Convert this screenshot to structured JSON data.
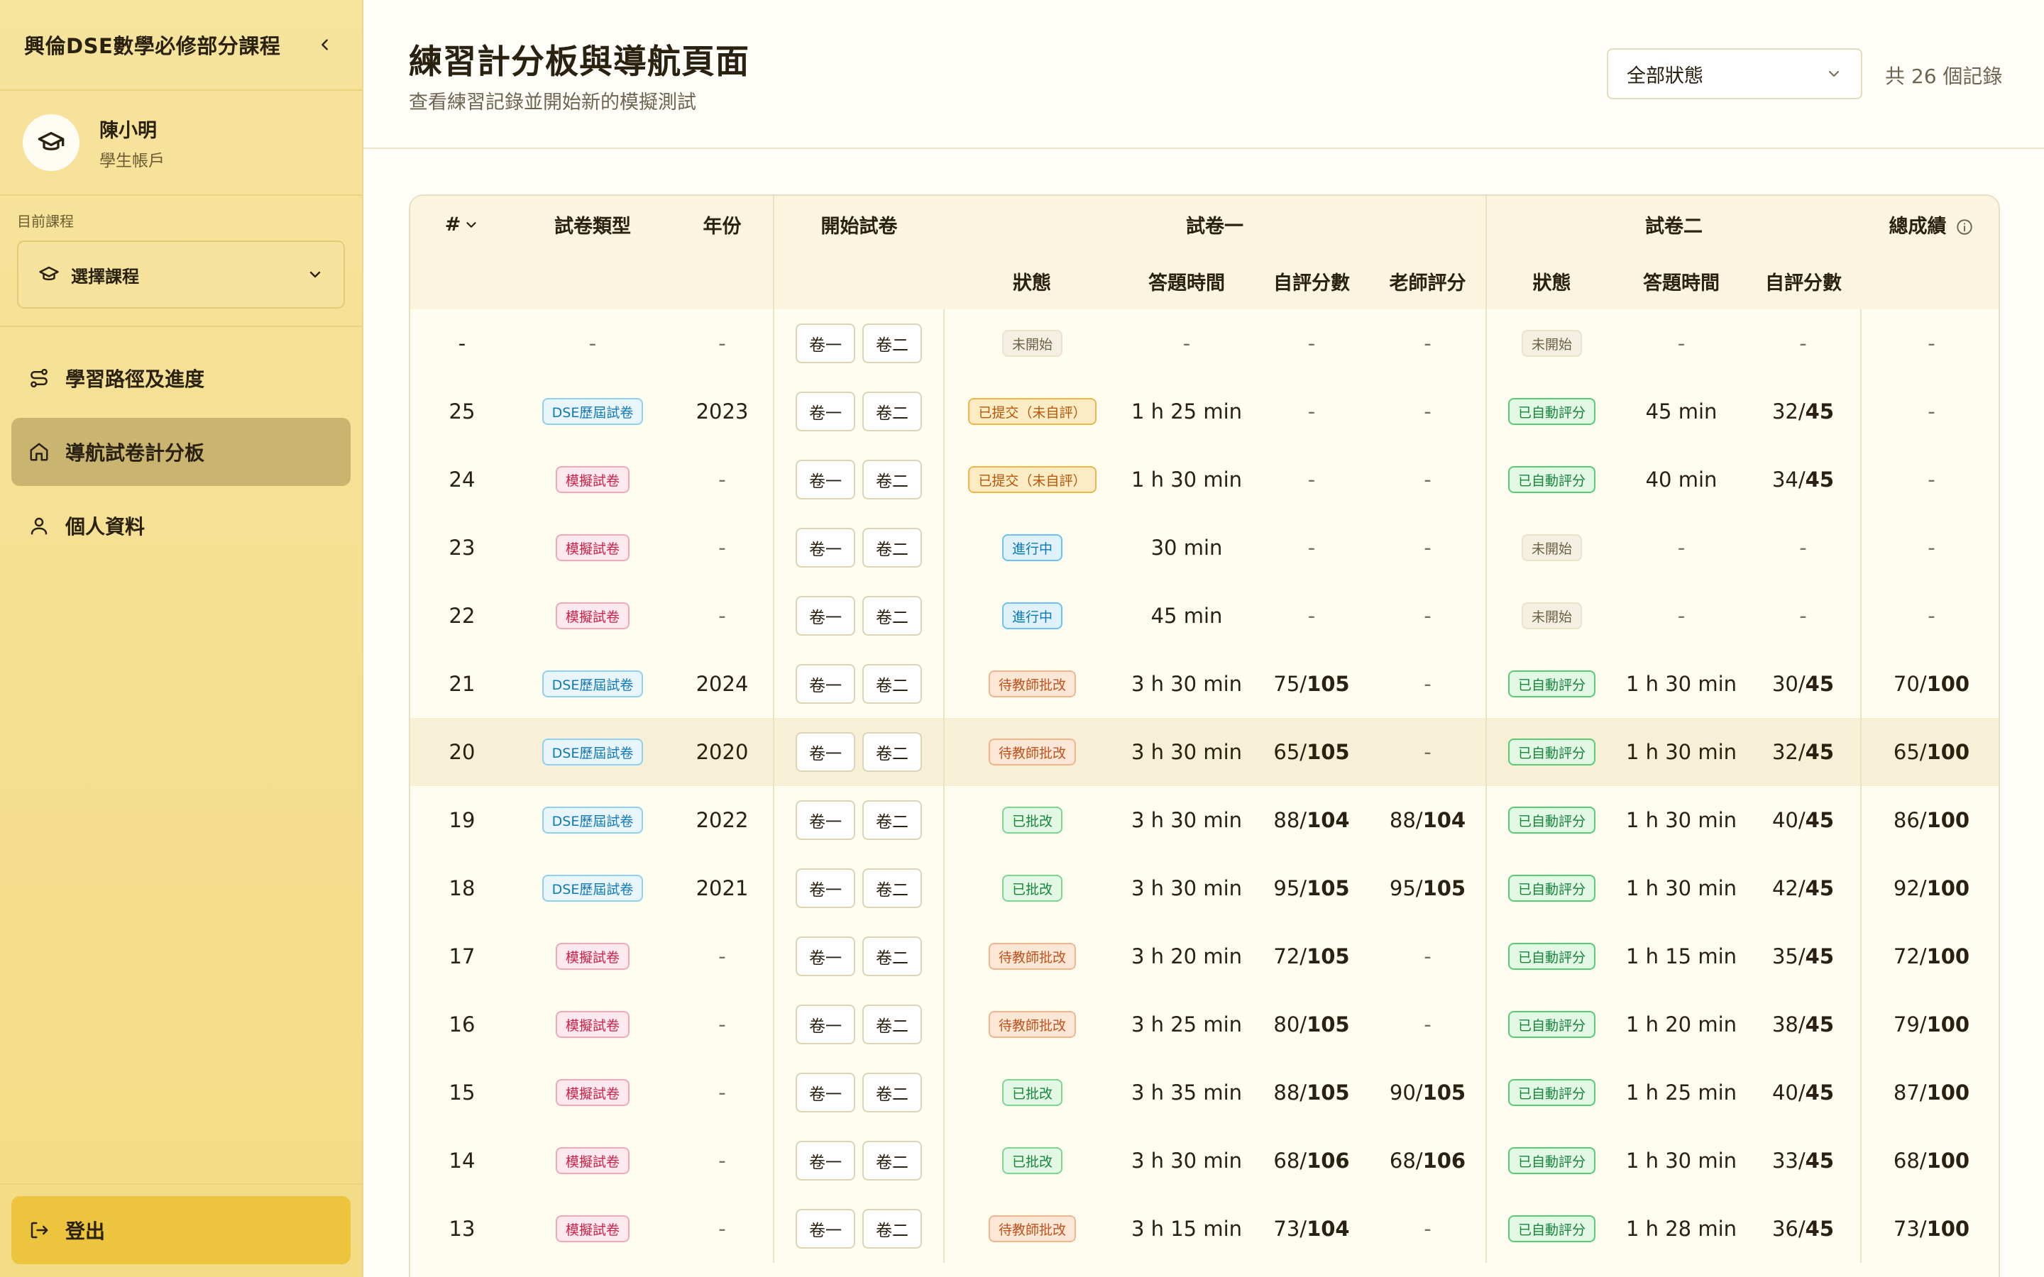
{
  "sidebar": {
    "course_title": "興倫DSE數學必修部分課程",
    "user": {
      "name": "陳小明",
      "role": "學生帳戶"
    },
    "course_label": "目前課程",
    "course_select": "選擇課程",
    "nav": [
      {
        "label": "學習路徑及進度",
        "icon": "route-icon"
      },
      {
        "label": "導航試卷計分板",
        "icon": "home-icon",
        "active": true
      },
      {
        "label": "個人資料",
        "icon": "user-icon"
      }
    ],
    "logout": "登出"
  },
  "header": {
    "title": "練習計分板與導航頁面",
    "subtitle": "查看練習記錄並開始新的模擬測試",
    "status_filter": "全部狀態",
    "count": "共 26 個記錄"
  },
  "table": {
    "headers": {
      "idx": "#",
      "type": "試卷類型",
      "year": "年份",
      "start": "開始試卷",
      "paper1": "試卷一",
      "paper2": "試卷二",
      "total": "總成績",
      "status": "狀態",
      "time": "答題時間",
      "self_score": "自評分數",
      "teacher_score": "老師評分"
    },
    "buttons": {
      "p1": "卷一",
      "p2": "卷二"
    },
    "rows": [
      {
        "idx": "-",
        "type": "-",
        "year": "-",
        "s1": "未開始",
        "s1k": "none",
        "t1": "-",
        "sc1": "-",
        "tc1": "-",
        "s2": "未開始",
        "s2k": "none",
        "t2": "-",
        "sc2": "-",
        "tot": "-"
      },
      {
        "idx": "25",
        "type": "DSE歷屆試卷",
        "tk": "dse",
        "year": "2023",
        "s1": "已提交（未自評）",
        "s1k": "submit",
        "t1": "1 h 25 min",
        "sc1": "-",
        "tc1": "-",
        "s2": "已自動評分",
        "s2k": "auto",
        "t2": "45 min",
        "sc2": "32/",
        "sc2b": "45",
        "tot": "-"
      },
      {
        "idx": "24",
        "type": "模擬試卷",
        "tk": "mock",
        "year": "-",
        "s1": "已提交（未自評）",
        "s1k": "submit",
        "t1": "1 h 30 min",
        "sc1": "-",
        "tc1": "-",
        "s2": "已自動評分",
        "s2k": "auto",
        "t2": "40 min",
        "sc2": "34/",
        "sc2b": "45",
        "tot": "-"
      },
      {
        "idx": "23",
        "type": "模擬試卷",
        "tk": "mock",
        "year": "-",
        "s1": "進行中",
        "s1k": "prog",
        "t1": "30 min",
        "sc1": "-",
        "tc1": "-",
        "s2": "未開始",
        "s2k": "none",
        "t2": "-",
        "sc2": "-",
        "tot": "-"
      },
      {
        "idx": "22",
        "type": "模擬試卷",
        "tk": "mock",
        "year": "-",
        "s1": "進行中",
        "s1k": "prog",
        "t1": "45 min",
        "sc1": "-",
        "tc1": "-",
        "s2": "未開始",
        "s2k": "none",
        "t2": "-",
        "sc2": "-",
        "tot": "-"
      },
      {
        "idx": "21",
        "type": "DSE歷屆試卷",
        "tk": "dse",
        "year": "2024",
        "s1": "待教師批改",
        "s1k": "wait",
        "t1": "3 h 30 min",
        "sc1": "75/",
        "sc1b": "105",
        "tc1": "-",
        "s2": "已自動評分",
        "s2k": "auto",
        "t2": "1 h 30 min",
        "sc2": "30/",
        "sc2b": "45",
        "tot": "70/",
        "totb": "100"
      },
      {
        "idx": "20",
        "type": "DSE歷屆試卷",
        "tk": "dse",
        "year": "2020",
        "hl": true,
        "s1": "待教師批改",
        "s1k": "wait",
        "t1": "3 h 30 min",
        "sc1": "65/",
        "sc1b": "105",
        "tc1": "-",
        "s2": "已自動評分",
        "s2k": "auto",
        "t2": "1 h 30 min",
        "sc2": "32/",
        "sc2b": "45",
        "tot": "65/",
        "totb": "100"
      },
      {
        "idx": "19",
        "type": "DSE歷屆試卷",
        "tk": "dse",
        "year": "2022",
        "s1": "已批改",
        "s1k": "done",
        "t1": "3 h 30 min",
        "sc1": "88/",
        "sc1b": "104",
        "tc1": "88/",
        "tc1b": "104",
        "s2": "已自動評分",
        "s2k": "auto",
        "t2": "1 h 30 min",
        "sc2": "40/",
        "sc2b": "45",
        "tot": "86/",
        "totb": "100"
      },
      {
        "idx": "18",
        "type": "DSE歷屆試卷",
        "tk": "dse",
        "year": "2021",
        "s1": "已批改",
        "s1k": "done",
        "t1": "3 h 30 min",
        "sc1": "95/",
        "sc1b": "105",
        "tc1": "95/",
        "tc1b": "105",
        "s2": "已自動評分",
        "s2k": "auto",
        "t2": "1 h 30 min",
        "sc2": "42/",
        "sc2b": "45",
        "tot": "92/",
        "totb": "100"
      },
      {
        "idx": "17",
        "type": "模擬試卷",
        "tk": "mock",
        "year": "-",
        "s1": "待教師批改",
        "s1k": "wait",
        "t1": "3 h 20 min",
        "sc1": "72/",
        "sc1b": "105",
        "tc1": "-",
        "s2": "已自動評分",
        "s2k": "auto",
        "t2": "1 h 15 min",
        "sc2": "35/",
        "sc2b": "45",
        "tot": "72/",
        "totb": "100"
      },
      {
        "idx": "16",
        "type": "模擬試卷",
        "tk": "mock",
        "year": "-",
        "s1": "待教師批改",
        "s1k": "wait",
        "t1": "3 h 25 min",
        "sc1": "80/",
        "sc1b": "105",
        "tc1": "-",
        "s2": "已自動評分",
        "s2k": "auto",
        "t2": "1 h 20 min",
        "sc2": "38/",
        "sc2b": "45",
        "tot": "79/",
        "totb": "100"
      },
      {
        "idx": "15",
        "type": "模擬試卷",
        "tk": "mock",
        "year": "-",
        "s1": "已批改",
        "s1k": "done",
        "t1": "3 h 35 min",
        "sc1": "88/",
        "sc1b": "105",
        "tc1": "90/",
        "tc1b": "105",
        "s2": "已自動評分",
        "s2k": "auto",
        "t2": "1 h 25 min",
        "sc2": "40/",
        "sc2b": "45",
        "tot": "87/",
        "totb": "100"
      },
      {
        "idx": "14",
        "type": "模擬試卷",
        "tk": "mock",
        "year": "-",
        "s1": "已批改",
        "s1k": "done",
        "t1": "3 h 30 min",
        "sc1": "68/",
        "sc1b": "106",
        "tc1": "68/",
        "tc1b": "106",
        "s2": "已自動評分",
        "s2k": "auto",
        "t2": "1 h 30 min",
        "sc2": "33/",
        "sc2b": "45",
        "tot": "68/",
        "totb": "100"
      },
      {
        "idx": "13",
        "type": "模擬試卷",
        "tk": "mock",
        "year": "-",
        "s1": "待教師批改",
        "s1k": "wait",
        "t1": "3 h 15 min",
        "sc1": "73/",
        "sc1b": "104",
        "tc1": "-",
        "s2": "已自動評分",
        "s2k": "auto",
        "t2": "1 h 28 min",
        "sc2": "36/",
        "sc2b": "45",
        "tot": "73/",
        "totb": "100"
      }
    ]
  }
}
